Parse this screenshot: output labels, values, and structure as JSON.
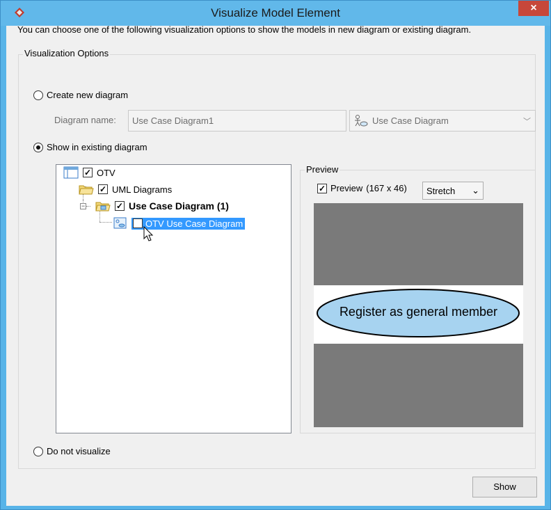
{
  "window": {
    "title": "Visualize Model Element",
    "close_glyph": "×"
  },
  "intro_text": "You can choose one of the following visualization options to show the models in new diagram or existing diagram.",
  "options": {
    "legend": "Visualization Options",
    "create_new": "Create new diagram",
    "diagram_name_label": "Diagram name:",
    "diagram_name_value": "Use Case Diagram1",
    "diagram_type_value": "Use Case Diagram",
    "show_existing": "Show in existing diagram",
    "do_not_visualize": "Do not visualize",
    "selected_option": "show_existing"
  },
  "tree": {
    "root": "OTV",
    "uml_folder": "UML Diagrams",
    "diagram_folder": "Use Case Diagram (1)",
    "diagram_item": "OTV Use Case Diagram"
  },
  "preview": {
    "legend": "Preview",
    "checkbox_label": "Preview",
    "size_text": "(167 x 46)",
    "scale_mode": "Stretch",
    "use_case_label": "Register as general member"
  },
  "buttons": {
    "show": "Show"
  },
  "colors": {
    "title_bar": "#61b8ea",
    "close_button": "#c7473a",
    "selection": "#3399ff",
    "use_case_fill": "#a7d3f0"
  },
  "icons": {
    "app": "app-logo-icon",
    "diagram_type": "use-case-diagram-icon",
    "root": "project-icon",
    "folder": "folder-icon",
    "diagram_folder": "diagram-folder-icon",
    "diagram": "diagram-icon",
    "chevron": "chevron-down-icon"
  }
}
